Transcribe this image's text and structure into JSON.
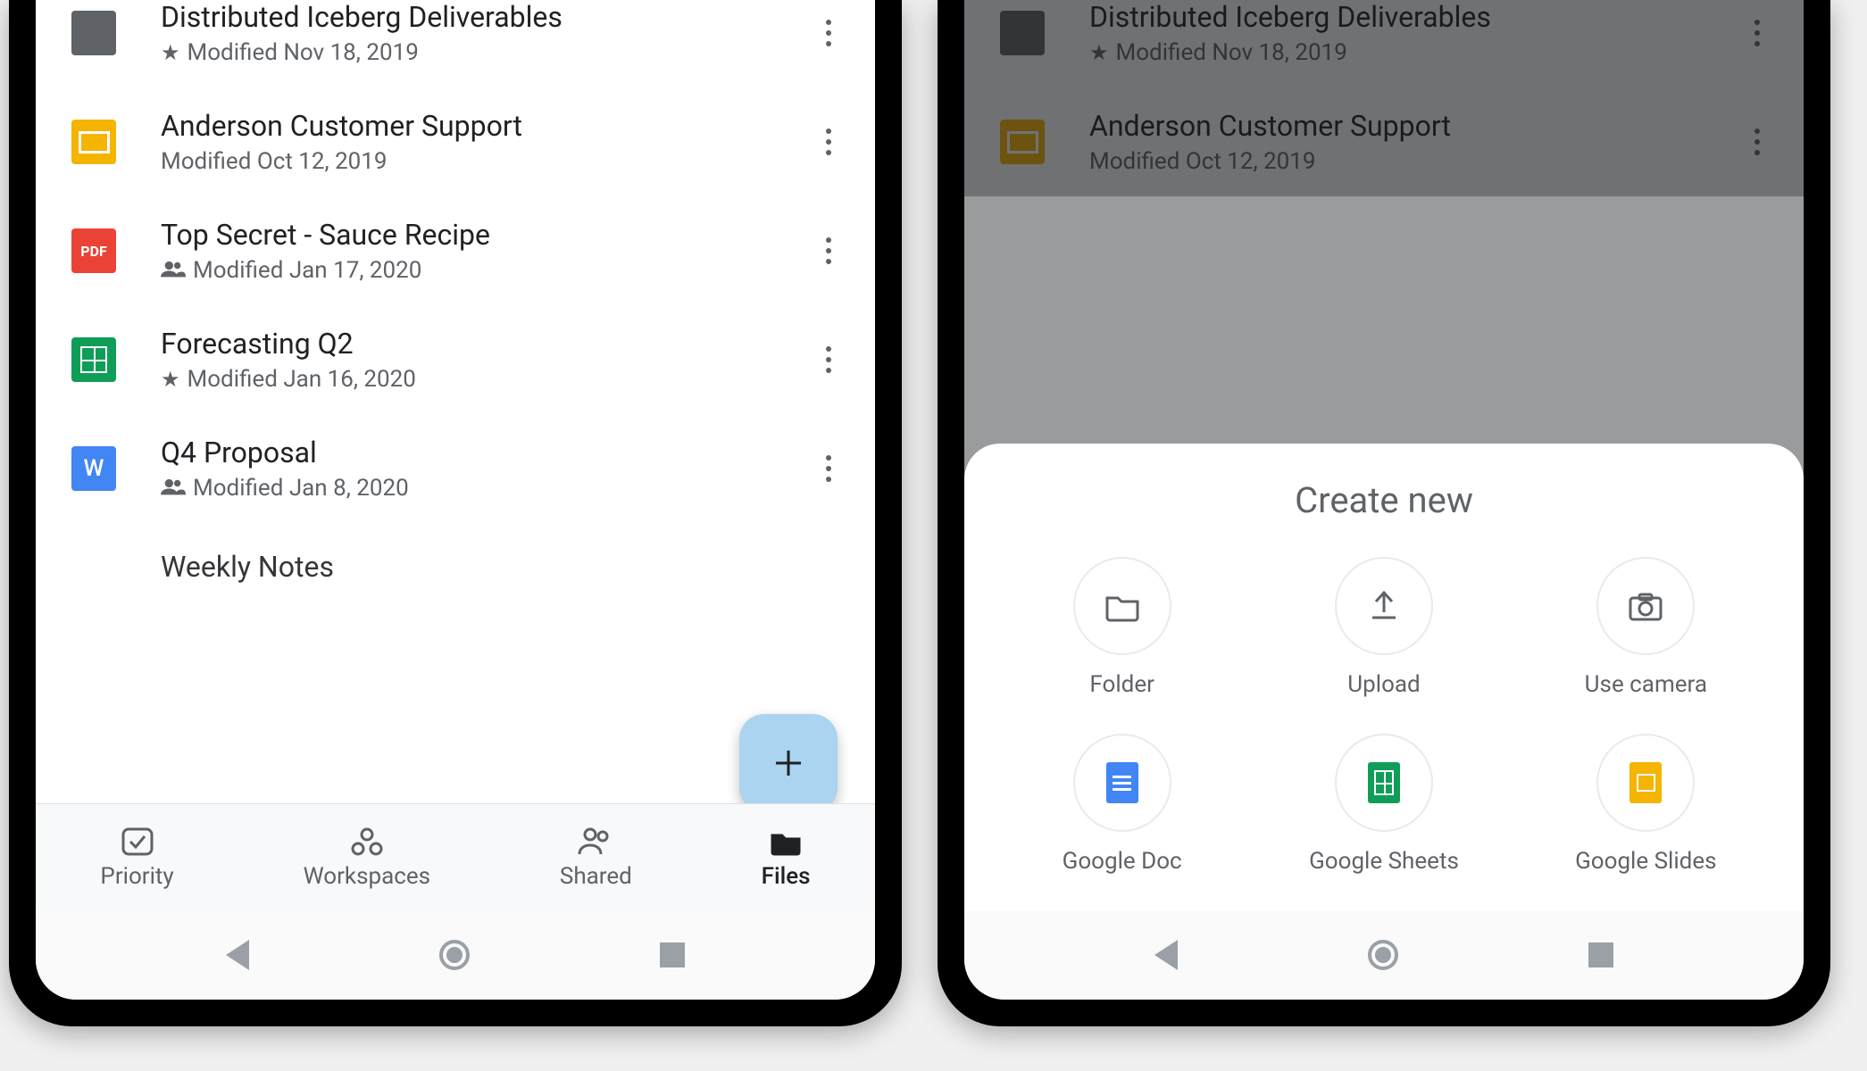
{
  "left": {
    "files": [
      {
        "icon": "folder",
        "title": "Distributed Iceberg Deliverables",
        "starred": true,
        "shared": false,
        "modified": "Modified Nov 18, 2019"
      },
      {
        "icon": "slides",
        "title": "Anderson Customer Support",
        "starred": false,
        "shared": false,
        "modified": "Modified Oct 12, 2019"
      },
      {
        "icon": "pdf",
        "title": "Top Secret - Sauce Recipe",
        "starred": false,
        "shared": true,
        "modified": "Modified Jan 17, 2020"
      },
      {
        "icon": "sheets",
        "title": "Forecasting Q2",
        "starred": true,
        "shared": false,
        "modified": "Modified Jan 16, 2020"
      },
      {
        "icon": "word",
        "title": "Q4 Proposal",
        "starred": false,
        "shared": true,
        "modified": "Modified Jan 8, 2020"
      },
      {
        "icon": "doc",
        "title": "Weekly Notes",
        "starred": false,
        "shared": false,
        "modified": ""
      }
    ],
    "nav": {
      "priority": "Priority",
      "workspaces": "Workspaces",
      "shared": "Shared",
      "files": "Files"
    }
  },
  "right": {
    "visible_files": [
      {
        "icon": "folder",
        "title": "Distributed Iceberg Deliverables",
        "modified": "Modified Nov 18, 2019"
      },
      {
        "icon": "slides",
        "title": "Anderson Customer Support",
        "modified": "Modified Oct 12, 2019"
      }
    ],
    "sheet": {
      "title": "Create new",
      "items": {
        "folder": "Folder",
        "upload": "Upload",
        "camera": "Use camera",
        "doc": "Google Doc",
        "sheets": "Google Sheets",
        "slides": "Google Slides"
      }
    }
  }
}
